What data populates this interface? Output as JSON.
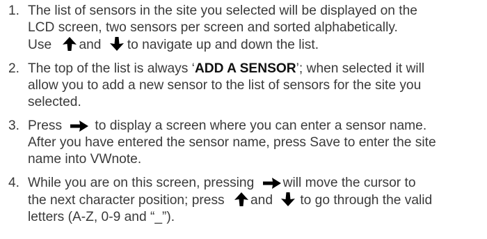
{
  "steps": [
    {
      "number": "1.",
      "lines": [
        "The list of sensors in the site you selected will be displayed on the",
        "LCD screen, two sensors per screen and sorted alphabetically.",
        "Use",
        "and",
        "to navigate up and down the list."
      ]
    },
    {
      "number": "2.",
      "before": "The top of the list is always ‘",
      "emphasis": "ADD A SENSOR",
      "after_line1": "’; when selected it will",
      "line2": "allow you to add a new sensor to the list of sensors for the site you",
      "line3": "selected."
    },
    {
      "number": "3.",
      "line1_before": "Press",
      "line1_after": "to display a screen where you can enter a sensor name.",
      "line2": "After you have entered the sensor name, press Save to enter the site",
      "line3": "name into VWnote."
    },
    {
      "number": "4.",
      "line1_before": "While you are on this screen, pressing",
      "line1_after": "will move the cursor to",
      "line2_before": "the next character position; press",
      "line2_mid": "and",
      "line2_after": "to go through the valid",
      "line3": "letters (A-Z, 0-9 and “_”)."
    }
  ],
  "icons": {
    "up": "arrow-up-icon",
    "down": "arrow-down-icon",
    "right": "arrow-right-icon"
  },
  "colors": {
    "text": "#3a3a3a",
    "emphasis": "#111111",
    "icon": "#000000"
  }
}
